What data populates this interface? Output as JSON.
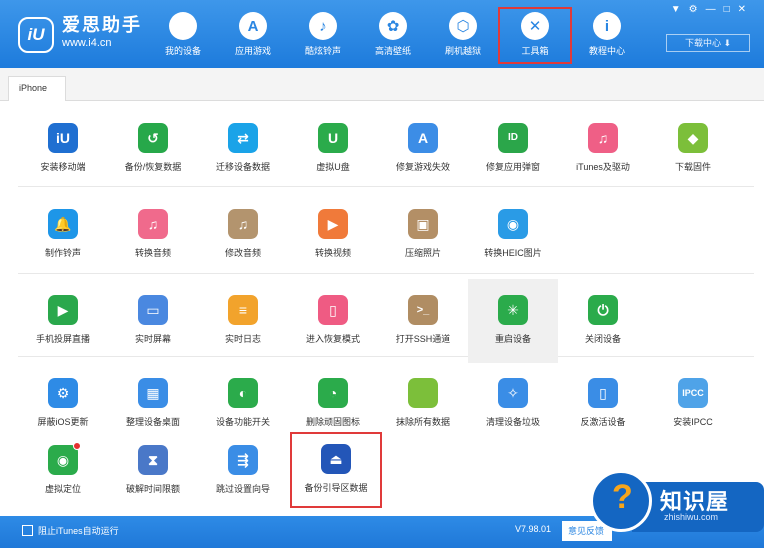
{
  "brand": {
    "logo_text": "iU",
    "name": "爱思助手",
    "url": "www.i4.cn"
  },
  "nav": [
    {
      "label": "我的设备",
      "glyph": ""
    },
    {
      "label": "应用游戏",
      "glyph": "A"
    },
    {
      "label": "酷炫铃声",
      "glyph": "♪"
    },
    {
      "label": "高清壁纸",
      "glyph": "✿"
    },
    {
      "label": "刷机越狱",
      "glyph": "⬡"
    },
    {
      "label": "工具箱",
      "glyph": "✕",
      "active": true
    },
    {
      "label": "教程中心",
      "glyph": "i"
    }
  ],
  "window_controls": [
    "▼",
    "⚙",
    "—",
    "□",
    "✕"
  ],
  "download_center": "下载中心  ⬇",
  "device_tab": "iPhone",
  "tools": [
    {
      "label": "安装移动端",
      "color": "#1f6fd1",
      "glyph": "iU"
    },
    {
      "label": "备份/恢复数据",
      "color": "#27a84a",
      "glyph": "↺"
    },
    {
      "label": "迁移设备数据",
      "color": "#1aa3e8",
      "glyph": "⇄"
    },
    {
      "label": "虚拟U盘",
      "color": "#2bab4b",
      "glyph": "U"
    },
    {
      "label": "修复游戏失效",
      "color": "#3c8de6",
      "glyph": "A"
    },
    {
      "label": "修复应用弹窗",
      "color": "#2ba64a",
      "glyph": "ID"
    },
    {
      "label": "iTunes及驱动",
      "color": "#ef5f86",
      "glyph": "♫"
    },
    {
      "label": "下载固件",
      "color": "#7cbf3a",
      "glyph": "◆"
    },
    {
      "label": "制作铃声",
      "color": "#1e96e8",
      "glyph": "🔔"
    },
    {
      "label": "转换音频",
      "color": "#f06a8c",
      "glyph": "♫"
    },
    {
      "label": "修改音频",
      "color": "#b3946e",
      "glyph": "♫"
    },
    {
      "label": "转换视频",
      "color": "#f07a3a",
      "glyph": "▶"
    },
    {
      "label": "压缩照片",
      "color": "#b38f66",
      "glyph": "▣"
    },
    {
      "label": "转换HEIC图片",
      "color": "#2a9be6",
      "glyph": "◉"
    },
    {
      "label": "手机投屏直播",
      "color": "#2aa84c",
      "glyph": "▶"
    },
    {
      "label": "实时屏幕",
      "color": "#4a88e0",
      "glyph": "▭"
    },
    {
      "label": "实时日志",
      "color": "#f2a32c",
      "glyph": "≡"
    },
    {
      "label": "进入恢复模式",
      "color": "#ef5b83",
      "glyph": "▯"
    },
    {
      "label": "打开SSH通道",
      "color": "#b08d63",
      "glyph": ">_"
    },
    {
      "label": "重启设备",
      "color": "#2bab4b",
      "glyph": "✳"
    },
    {
      "label": "关闭设备",
      "color": "#2bab4b",
      "glyph": "⏻"
    },
    {
      "label": "屏蔽iOS更新",
      "color": "#2e8be6",
      "glyph": "⚙"
    },
    {
      "label": "整理设备桌面",
      "color": "#3a8de6",
      "glyph": "▦"
    },
    {
      "label": "设备功能开关",
      "color": "#2bab4b",
      "glyph": "◐"
    },
    {
      "label": "删除顽固图标",
      "color": "#2bab4b",
      "glyph": "◔"
    },
    {
      "label": "抹除所有数据",
      "color": "#7cbf3a",
      "glyph": ""
    },
    {
      "label": "清理设备垃圾",
      "color": "#3a8de6",
      "glyph": "✧"
    },
    {
      "label": "反激活设备",
      "color": "#3a8de6",
      "glyph": "▯"
    },
    {
      "label": "安装IPCC",
      "color": "#4fa3e8",
      "glyph": "IPCC"
    },
    {
      "label": "虚拟定位",
      "color": "#2bab4b",
      "glyph": "◉"
    },
    {
      "label": "破解时间限额",
      "color": "#4a78c8",
      "glyph": "⧗"
    },
    {
      "label": "跳过设置向导",
      "color": "#3a8de6",
      "glyph": "⇶"
    },
    {
      "label": "备份引导区数据",
      "color": "#2356b8",
      "glyph": "⏏"
    }
  ],
  "footer": {
    "checkbox_label": "阻止iTunes自动运行",
    "version": "V7.98.01",
    "feedback": "意见反馈"
  },
  "watermark": {
    "glyph": "?",
    "title": "知识屋",
    "url": "zhishiwu.com"
  }
}
